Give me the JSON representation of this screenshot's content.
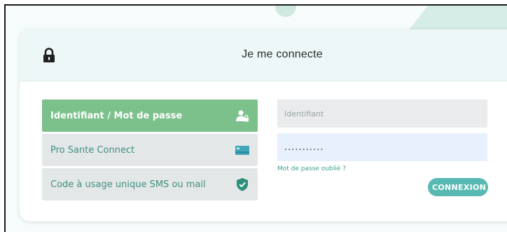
{
  "header": {
    "title": "Je me connecte",
    "lock_icon": "lock-icon"
  },
  "methods": [
    {
      "label": "Identifiant / Mot de passe",
      "icon": "user-lock-icon",
      "active": true
    },
    {
      "label": "Pro Sante Connect",
      "icon": "card-icon",
      "active": false
    },
    {
      "label": "Code à usage unique SMS ou mail",
      "icon": "shield-check-icon",
      "active": false
    }
  ],
  "form": {
    "identifier_placeholder": "Identifiant",
    "identifier_value": "",
    "password_value": "...........",
    "forgot_link": "Mot de passe oublié ?",
    "submit_label": "CONNEXION"
  },
  "colors": {
    "active_method": "#7cc08c",
    "accent": "#58b9b3",
    "link": "#3d9e92",
    "header_bg": "#edf7f8"
  }
}
